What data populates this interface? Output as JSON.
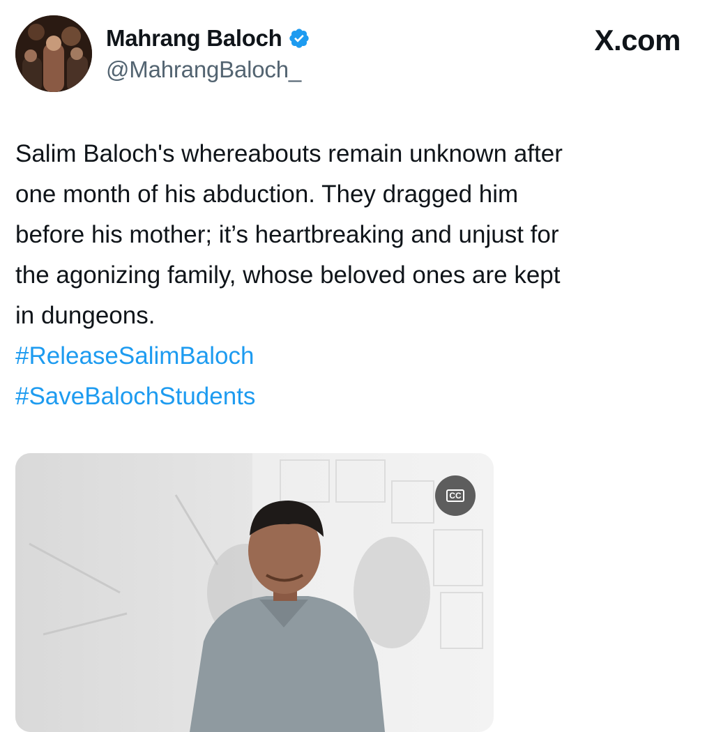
{
  "author": {
    "display_name": "Mahrang Baloch",
    "handle": "@MahrangBaloch_",
    "avatar_icon": "profile-photo",
    "verified_icon": "verified-badge-icon",
    "verified_color": "#1d9bf0"
  },
  "brand": {
    "label": "X.com"
  },
  "tweet": {
    "lines": [
      "Salim Baloch's whereabouts remain unknown after",
      "one month of his abduction. They dragged him",
      "before his mother; it’s heartbreaking and unjust for",
      "the agonizing family, whose beloved ones are kept",
      "in dungeons."
    ],
    "hashtags": [
      "#ReleaseSalimBaloch",
      "#SaveBalochStudents"
    ],
    "hashtag_color": "#1d9bf0"
  },
  "media": {
    "type": "video",
    "cc_label": "CC",
    "cc_icon": "closed-captions-icon"
  }
}
